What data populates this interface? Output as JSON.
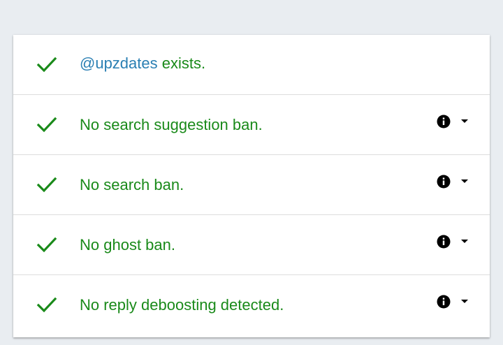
{
  "colors": {
    "success": "#1a8a1a",
    "handle": "#2a7fb3",
    "background": "#e9edf1",
    "card": "#ffffff"
  },
  "results": [
    {
      "handle": "@upzdates",
      "text": " exists.",
      "has_details": false,
      "icon": "check-icon"
    },
    {
      "text": "No search suggestion ban.",
      "has_details": true,
      "icon": "check-icon"
    },
    {
      "text": "No search ban.",
      "has_details": true,
      "icon": "check-icon"
    },
    {
      "text": "No ghost ban.",
      "has_details": true,
      "icon": "check-icon"
    },
    {
      "text": "No reply deboosting detected.",
      "has_details": true,
      "icon": "check-icon"
    }
  ]
}
